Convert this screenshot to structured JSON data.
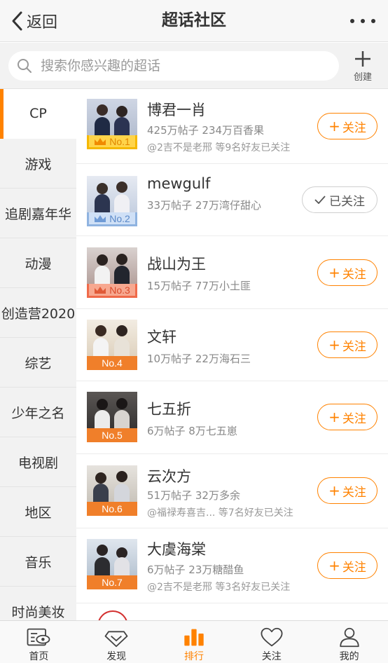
{
  "header": {
    "back_label": "返回",
    "title": "超话社区"
  },
  "search": {
    "placeholder": "搜索你感兴趣的超话",
    "create_label": "创建"
  },
  "categories": [
    "CP",
    "游戏",
    "追剧嘉年华",
    "动漫",
    "创造营2020",
    "综艺",
    "少年之名",
    "电视剧",
    "地区",
    "音乐",
    "时尚美妆"
  ],
  "active_category": "CP",
  "topics": [
    {
      "rank": "No.1",
      "name": "博君一肖",
      "stats": "425万帖子 234万百香果",
      "friends": "@2吉不是老邢 等9名好友已关注",
      "followed": false
    },
    {
      "rank": "No.2",
      "name": "mewgulf",
      "stats": "33万帖子 27万湾仔甜心",
      "friends": "",
      "followed": true
    },
    {
      "rank": "No.3",
      "name": "战山为王",
      "stats": "15万帖子 77万小土匪",
      "friends": "",
      "followed": false
    },
    {
      "rank": "No.4",
      "name": "文轩",
      "stats": "10万帖子 22万海石三",
      "friends": "",
      "followed": false
    },
    {
      "rank": "No.5",
      "name": "七五折",
      "stats": "6万帖子 8万七五崽",
      "friends": "",
      "followed": false
    },
    {
      "rank": "No.6",
      "name": "云次方",
      "stats": "51万帖子 32万多余",
      "friends": "@福禄寿喜吉... 等7名好友已关注",
      "followed": false
    },
    {
      "rank": "No.7",
      "name": "大虞海棠",
      "stats": "6万帖子 23万糖醋鱼",
      "friends": "@2吉不是老邢 等3名好友已关注",
      "followed": false
    }
  ],
  "buttons": {
    "follow_label": "关注",
    "follow_plus": "+",
    "followed_label": "已关注"
  },
  "tabbar": {
    "items": [
      "首页",
      "发现",
      "排行",
      "关注",
      "我的"
    ],
    "active": "排行"
  },
  "colors": {
    "accent": "#ff8200",
    "gold": "#f5b800",
    "silver": "#8fb3e0",
    "bronze": "#ef6a4a"
  }
}
